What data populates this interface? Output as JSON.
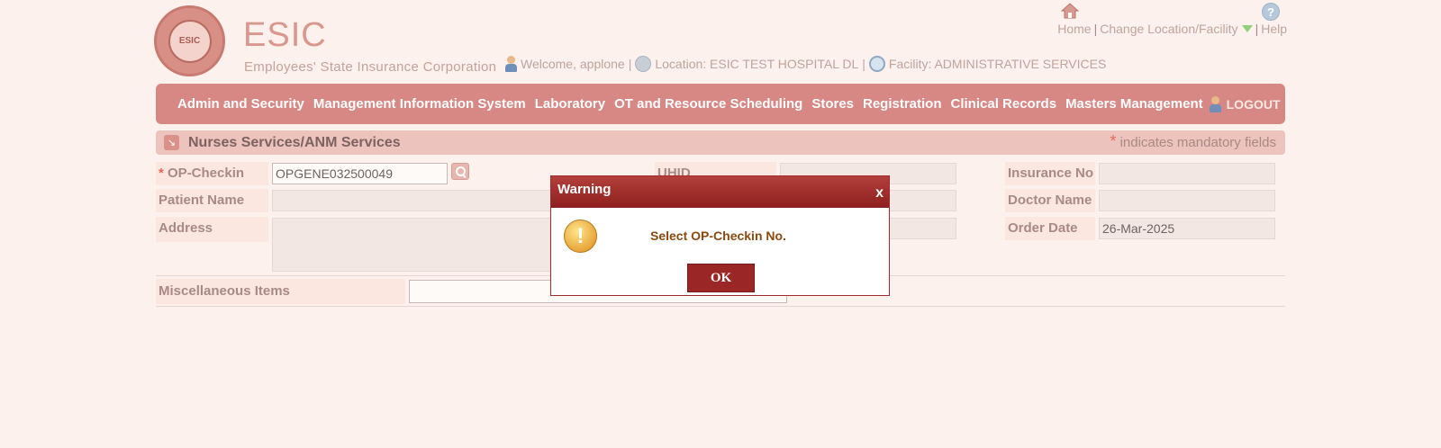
{
  "header": {
    "logo_text": "ESIC",
    "brand_name": "ESIC",
    "brand_sub": "Employees' State Insurance Corporation",
    "links": {
      "home": "Home",
      "change_location": "Change Location/Facility",
      "help": "Help",
      "separator": "|"
    },
    "info": {
      "welcome": "Welcome, applone",
      "location": "Location: ESIC TEST HOSPITAL DL",
      "facility": "Facility: ADMINISTRATIVE SERVICES",
      "separator": "|"
    }
  },
  "menu": {
    "items": [
      "Admin and Security",
      "Management Information System",
      "Laboratory",
      "OT and Resource Scheduling",
      "Stores",
      "Registration",
      "Clinical Records",
      "Masters Management"
    ],
    "logout": "LOGOUT"
  },
  "section": {
    "title": "Nurses Services/ANM Services",
    "mandatory_star": "*",
    "mandatory_text": "indicates mandatory fields"
  },
  "form": {
    "op_checkin_label": "OP-Checkin No.",
    "op_checkin_value": "OPGENE032500049",
    "required_star": "*",
    "uhid_label": "UHID",
    "uhid_value": "",
    "insurance_label": "Insurance No",
    "insurance_value": "",
    "patient_name_label": "Patient Name",
    "patient_name_value": "",
    "doctor_name_label": "Doctor Name",
    "doctor_name_value": "",
    "address_label": "Address",
    "address_value": "",
    "order_date_label": "Order Date",
    "order_date_value": "26-Mar-2025",
    "misc_label": "Miscellaneous Items",
    "misc_value": ""
  },
  "modal": {
    "title": "Warning",
    "close": "x",
    "icon": "!",
    "message": "Select OP-Checkin No.",
    "ok": "OK"
  },
  "colors": {
    "background": "#fcf1ec",
    "menubar": "#d88884",
    "modal_header": "#a42b2b",
    "required": "#e26a5c"
  }
}
